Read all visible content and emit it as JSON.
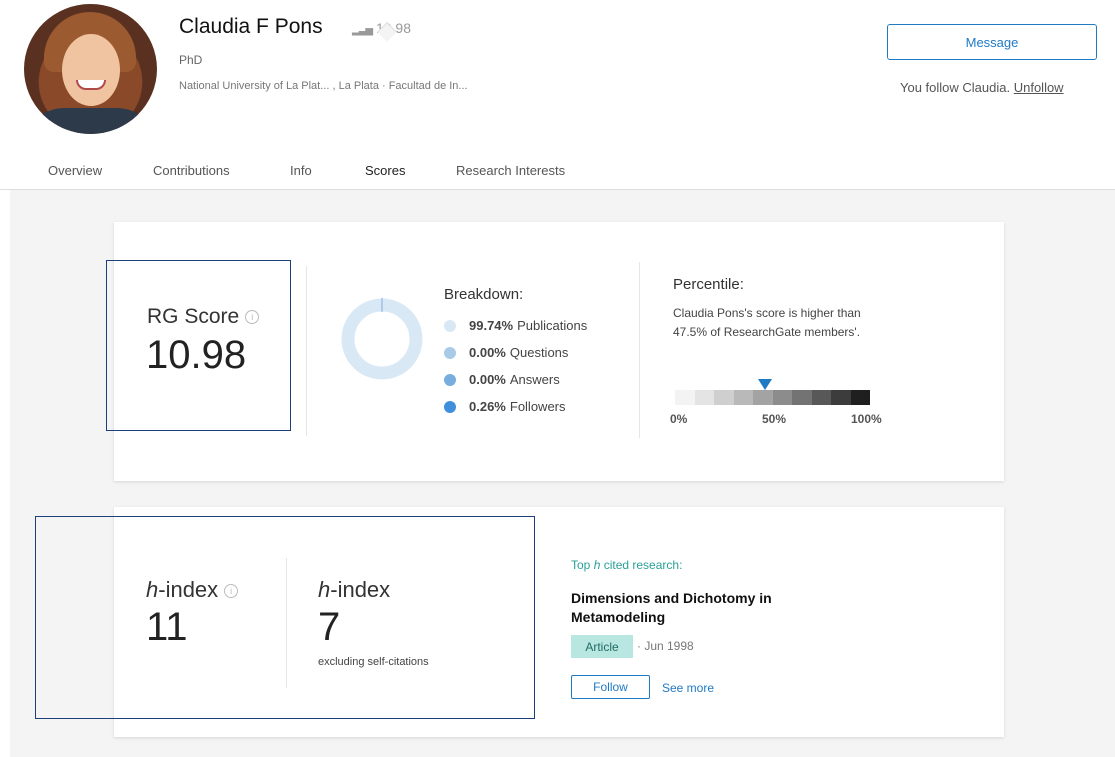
{
  "profile": {
    "name": "Claudia F Pons",
    "score_badge": "10.98",
    "degree": "PhD",
    "affiliation": "National University of La Plat... , La Plata · Facultad de In..."
  },
  "actions": {
    "message_label": "Message",
    "follow_status": "You follow Claudia. ",
    "unfollow_label": "Unfollow"
  },
  "tabs": [
    {
      "label": "Overview"
    },
    {
      "label": "Contributions"
    },
    {
      "label": "Info"
    },
    {
      "label": "Scores",
      "active": true
    },
    {
      "label": "Research Interests"
    }
  ],
  "rg": {
    "label": "RG Score",
    "value": "10.98",
    "info_glyph": "i"
  },
  "breakdown": {
    "title": "Breakdown:",
    "items": [
      {
        "pct": "99.74%",
        "label": "Publications",
        "color": "#d9e8f5"
      },
      {
        "pct": "0.00%",
        "label": "Questions",
        "color": "#a9cbe8"
      },
      {
        "pct": "0.00%",
        "label": "Answers",
        "color": "#78aede"
      },
      {
        "pct": "0.26%",
        "label": "Followers",
        "color": "#3f8fdc"
      }
    ]
  },
  "percentile": {
    "title": "Percentile:",
    "text": "Claudia Pons's score is higher than 47.5% of ResearchGate members'.",
    "value": 47.5,
    "ticks": [
      "0%",
      "50%",
      "100%"
    ],
    "scale_colors": [
      "#f3f3f3",
      "#e4e4e4",
      "#cfcfcf",
      "#b9b9b9",
      "#a3a3a3",
      "#8c8c8c",
      "#737373",
      "#585858",
      "#3c3c3c",
      "#1f1f1f"
    ]
  },
  "hindex": {
    "label_italic": "h",
    "label_rest": "-index",
    "value": "11",
    "info_glyph": "i",
    "excl_label_italic": "h",
    "excl_label_rest": "-index",
    "excl_value": "7",
    "excl_sub": "excluding self-citations"
  },
  "top_research": {
    "label_pre": "Top ",
    "label_italic": "h",
    "label_post": " cited research:",
    "title": "Dimensions and Dichotomy in Metamodeling",
    "type": "Article",
    "date": "· Jun 1998",
    "follow_label": "Follow",
    "see_more_label": "See more"
  },
  "colors": {
    "accent": "#1f7ac4",
    "teal": "#2aa197",
    "badge_bg": "#b8e6e0",
    "outline": "#1a3f7a"
  }
}
